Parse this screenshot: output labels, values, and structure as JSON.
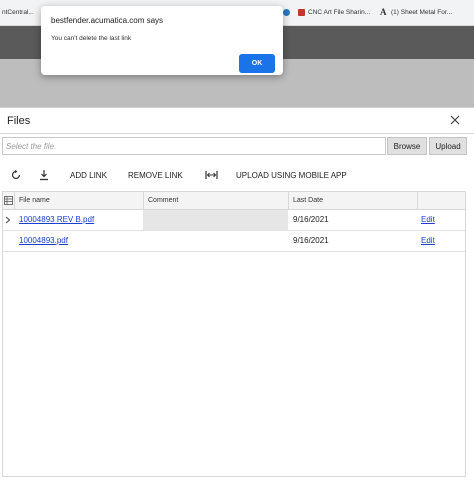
{
  "bookmarks": [
    {
      "label": "ntCentral..."
    },
    {
      "label": "CNC Art File Sharin..."
    },
    {
      "label": "(1) Sheet Metal For..."
    }
  ],
  "alert": {
    "title": "bestfender.acumatica.com says",
    "message": "You can't delete the last link",
    "ok_label": "OK"
  },
  "files_dialog": {
    "title": "Files",
    "file_input_placeholder": "Select the file.",
    "browse_label": "Browse",
    "upload_label": "Upload",
    "toolbar": {
      "refresh_icon": "refresh-icon",
      "download_icon": "download-icon",
      "add_link_label": "ADD LINK",
      "remove_link_label": "REMOVE LINK",
      "fit_icon": "fit-columns-icon",
      "upload_mobile_label": "UPLOAD USING MOBILE APP"
    },
    "columns": {
      "file_name": "File name",
      "comment": "Comment",
      "last_date": "Last Date"
    },
    "rows": [
      {
        "file_name": "10004893 REV B.pdf",
        "comment": "",
        "last_date": "9/16/2021",
        "action": "Edit"
      },
      {
        "file_name": "10004893.pdf",
        "comment": "",
        "last_date": "9/16/2021",
        "action": "Edit"
      }
    ]
  },
  "colors": {
    "accent": "#1a73e8",
    "link": "#1a3fd0",
    "header_dark": "#5a5a5a"
  }
}
